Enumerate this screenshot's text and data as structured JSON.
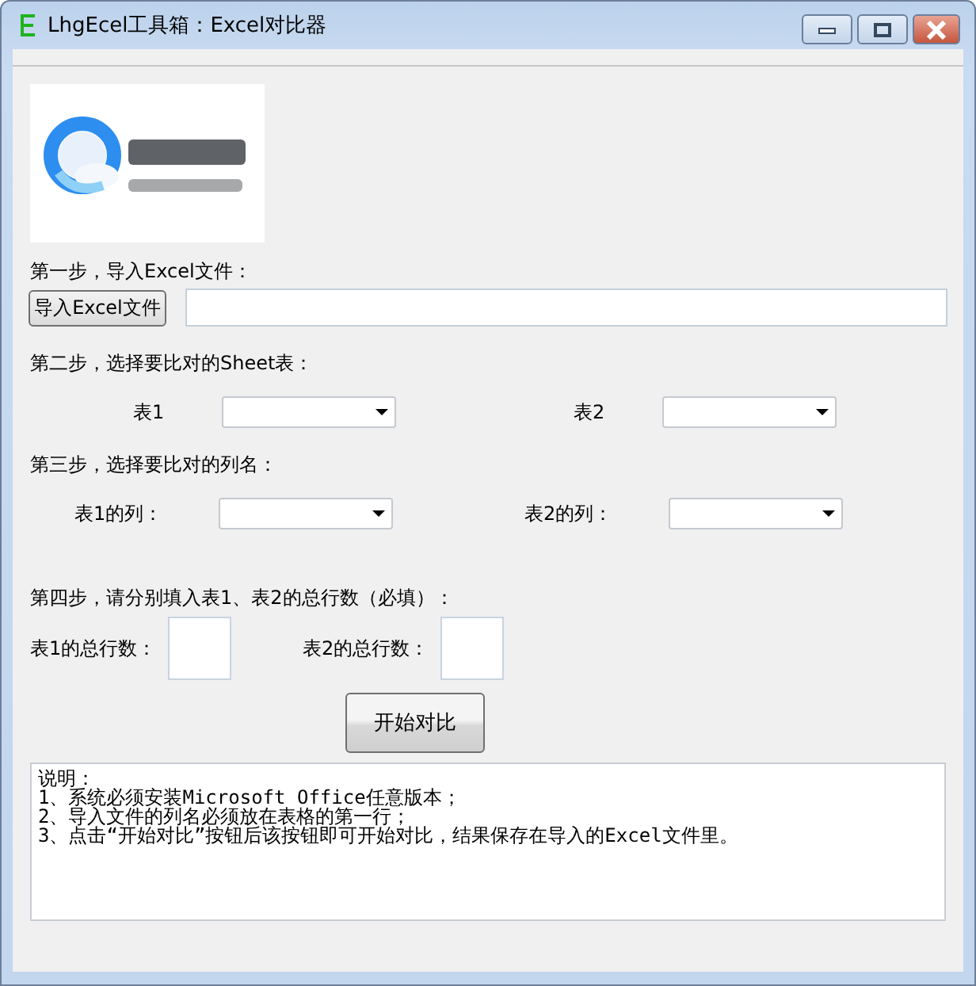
{
  "window": {
    "title": "LhgEcel工具箱：Excel对比器"
  },
  "steps": [
    {
      "kind": "import",
      "label": "第一步，导入Excel文件：",
      "button": "导入Excel文件"
    },
    {
      "kind": "combos",
      "label": "第二步，选择要比对的Sheet表：",
      "fields": [
        {
          "label": "表1"
        },
        {
          "label": "表2"
        }
      ]
    },
    {
      "kind": "combos",
      "label": "第三步，选择要比对的列名：",
      "fields": [
        {
          "label": "表1的列："
        },
        {
          "label": "表2的列："
        }
      ]
    },
    {
      "kind": "counts",
      "label": "第四步，请分别填入表1、表2的总行数（必填）：",
      "fields": [
        {
          "label": "表1的总行数："
        },
        {
          "label": "表2的总行数："
        }
      ]
    }
  ],
  "start_button": "开始对比",
  "notes": [
    "说明：",
    "1、系统必须安装Microsoft Office任意版本；",
    "2、导入文件的列名必须放在表格的第一行；",
    "3、点击“开始对比”按钮后该按钮即可开始对比，结果保存在导入的Excel文件里。"
  ]
}
